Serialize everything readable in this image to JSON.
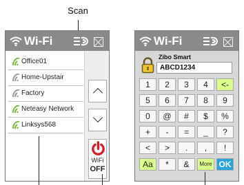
{
  "annotation": {
    "scan_label": "Scan"
  },
  "left_panel": {
    "title": "Wi-Fi",
    "networks": [
      {
        "label": "Office01"
      },
      {
        "label": "Home-Upstair"
      },
      {
        "label": "Factory"
      },
      {
        "label": "Neteasy Network"
      },
      {
        "label": "Linksys568"
      }
    ],
    "wifi_toggle": {
      "name": "WiFi",
      "state": "OFF"
    }
  },
  "right_panel": {
    "title": "Wi-Fi",
    "network_name": "Zibo Smart",
    "password": "ABCD1234",
    "keys": [
      [
        "1",
        "2",
        "3",
        "4",
        "<-"
      ],
      [
        "5",
        "6",
        "7",
        "8",
        "9"
      ],
      [
        "0",
        "@",
        "#",
        "$",
        "%"
      ],
      [
        "+",
        "-",
        "=",
        "_",
        "?"
      ],
      [
        "<",
        ">",
        ".",
        ",",
        "!"
      ],
      [
        "Aa",
        "*",
        "&",
        "More",
        "OK"
      ]
    ]
  },
  "colors": {
    "title_bar": "#8a8a8a",
    "wifi_green": "#79b83b",
    "power_red": "#d71f24",
    "ok_blue": "#27a3df",
    "accent_key": "#d8ff8a"
  }
}
